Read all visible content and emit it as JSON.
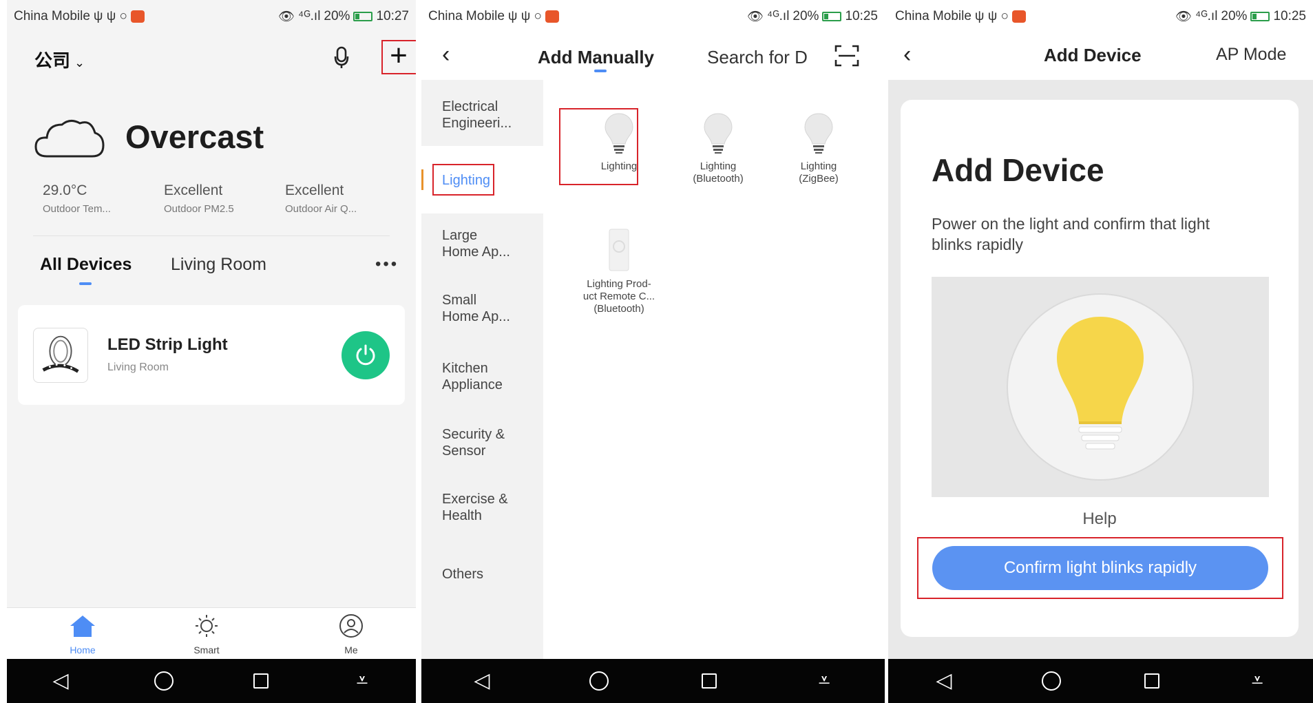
{
  "status_bar": {
    "left": {
      "carrier": "China Mobile",
      "extras": "ψ ψ ○"
    },
    "right": {
      "signal": "⁴ᴳ.ıl",
      "battery": "20%",
      "time_1": "10:27",
      "time_2": "10:25",
      "time_3": "10:25"
    }
  },
  "screen1": {
    "home_name": "公司",
    "weather": {
      "condition": "Overcast"
    },
    "stats": [
      {
        "value": "29.0°C",
        "label": "Outdoor Tem..."
      },
      {
        "value": "Excellent",
        "label": "Outdoor PM2.5"
      },
      {
        "value": "Excellent",
        "label": "Outdoor Air Q..."
      }
    ],
    "tabs": [
      "All Devices",
      "Living Room"
    ],
    "device": {
      "name": "LED Strip Light",
      "room": "Living Room"
    },
    "bottom_tabs": [
      {
        "label": "Home",
        "icon": "home-icon"
      },
      {
        "label": "Smart",
        "icon": "sun-icon"
      },
      {
        "label": "Me",
        "icon": "profile-icon"
      }
    ]
  },
  "screen2": {
    "title": "Add Manually",
    "search": "Search for D",
    "categories": [
      [
        "Electrical",
        "Engineeri..."
      ],
      [
        "Lighting"
      ],
      [
        "Large",
        "Home Ap..."
      ],
      [
        "Small",
        "Home Ap..."
      ],
      [
        "Kitchen",
        "Appliance"
      ],
      [
        "Security &",
        "Sensor"
      ],
      [
        "Exercise &",
        "Health"
      ],
      [
        "Others"
      ]
    ],
    "products": [
      [
        "Lighting"
      ],
      [
        "Lighting",
        "(Bluetooth)"
      ],
      [
        "Lighting",
        "(ZigBee)"
      ],
      [
        "Lighting Prod-",
        "uct Remote C...",
        "(Bluetooth)"
      ]
    ]
  },
  "screen3": {
    "title": "Add Device",
    "ap_mode": "AP Mode",
    "heading": "Add Device",
    "instruction": "Power on the light and confirm that light blinks  rapidly",
    "help": "Help",
    "confirm": "Confirm light blinks rapidly"
  },
  "colors": {
    "accent": "#4e8df5",
    "power": "#1ec587",
    "highlight": "#d8232a",
    "confirm": "#5b93f2",
    "bulb": "#f6d64a"
  },
  "nav_icons": [
    "back-triangle-icon",
    "home-circle-icon",
    "recents-square-icon",
    "notification-pull-icon"
  ]
}
